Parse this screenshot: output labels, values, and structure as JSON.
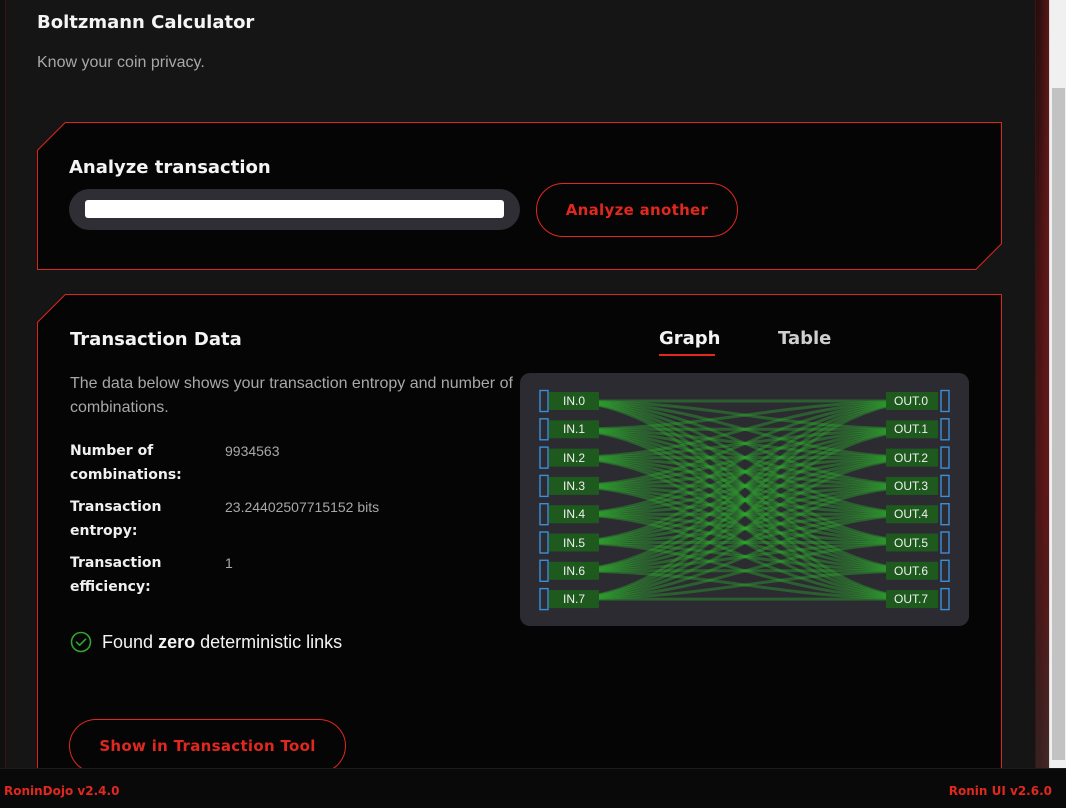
{
  "header": {
    "title": "Boltzmann Calculator",
    "subtitle": "Know your coin privacy."
  },
  "analyze": {
    "heading": "Analyze transaction",
    "txid_value": "",
    "button_label": "Analyze another"
  },
  "transaction_data": {
    "heading": "Transaction Data",
    "tabs": [
      {
        "label": "Graph",
        "active": true
      },
      {
        "label": "Table",
        "active": false
      }
    ],
    "description": "The data below shows your transaction entropy and number of combinations.",
    "stats": [
      {
        "label": "Number of combinations:",
        "value": "9934563"
      },
      {
        "label": "Transaction entropy:",
        "value": "23.24402507715152 bits"
      },
      {
        "label": "Transaction efficiency:",
        "value": "1"
      }
    ],
    "links_status": {
      "prefix": "Found",
      "emphasis": "zero",
      "suffix": "deterministic links",
      "icon": "check-circle-icon"
    },
    "graph": {
      "inputs": [
        "IN.0",
        "IN.1",
        "IN.2",
        "IN.3",
        "IN.4",
        "IN.5",
        "IN.6",
        "IN.7"
      ],
      "outputs": [
        "OUT.0",
        "OUT.1",
        "OUT.2",
        "OUT.3",
        "OUT.4",
        "OUT.5",
        "OUT.6",
        "OUT.7"
      ]
    },
    "show_button_label": "Show in Transaction Tool"
  },
  "footer": {
    "left": "RoninDojo v2.4.0",
    "right": "Ronin UI v2.6.0"
  },
  "colors": {
    "accent": "#e0281e",
    "link_green": "#2ea82e",
    "node_border": "#3b8fd9"
  }
}
